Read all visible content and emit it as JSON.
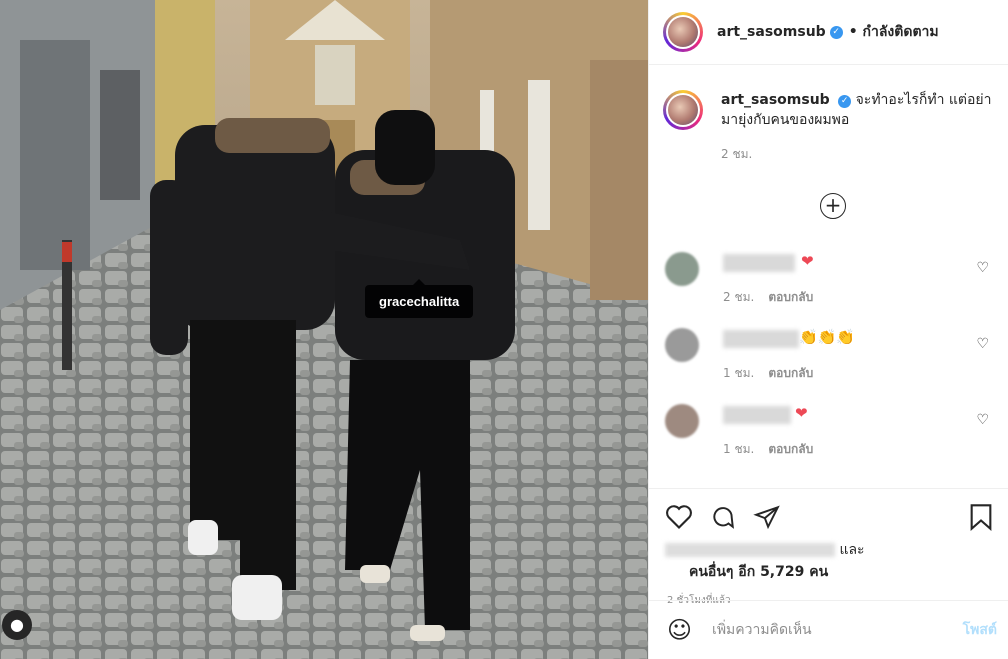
{
  "post": {
    "username": "art_sasomsub",
    "verified_icon": "verified-badge-icon",
    "follow_status": "• กำลังติดตาม",
    "tag_label": "gracechalitta",
    "caption": "จะทำอะไรก็ทำ แต่อย่ามายุ่งกับคนของผมพอ",
    "caption_time": "2 ชม."
  },
  "comments": [
    {
      "emoji": "❤",
      "time": "2 ชม.",
      "reply": "ตอบกลับ"
    },
    {
      "emoji": "👏👏👏",
      "time": "1 ชม.",
      "reply": "ตอบกลับ"
    },
    {
      "emoji": "❤",
      "time": "1 ชม.",
      "reply": "ตอบกลับ"
    }
  ],
  "likes": {
    "and_label": "และ",
    "others_label": "คนอื่นๆ อีก 5,729 คน"
  },
  "posted_ago": "2 ชั่วโมงที่แล้ว",
  "composer": {
    "placeholder": "เพิ่มความคิดเห็น",
    "post_label": "โพสต์"
  },
  "colors": {
    "accent": "#3897f0",
    "like": "#ed4956",
    "post_disabled": "#b2dffc"
  }
}
